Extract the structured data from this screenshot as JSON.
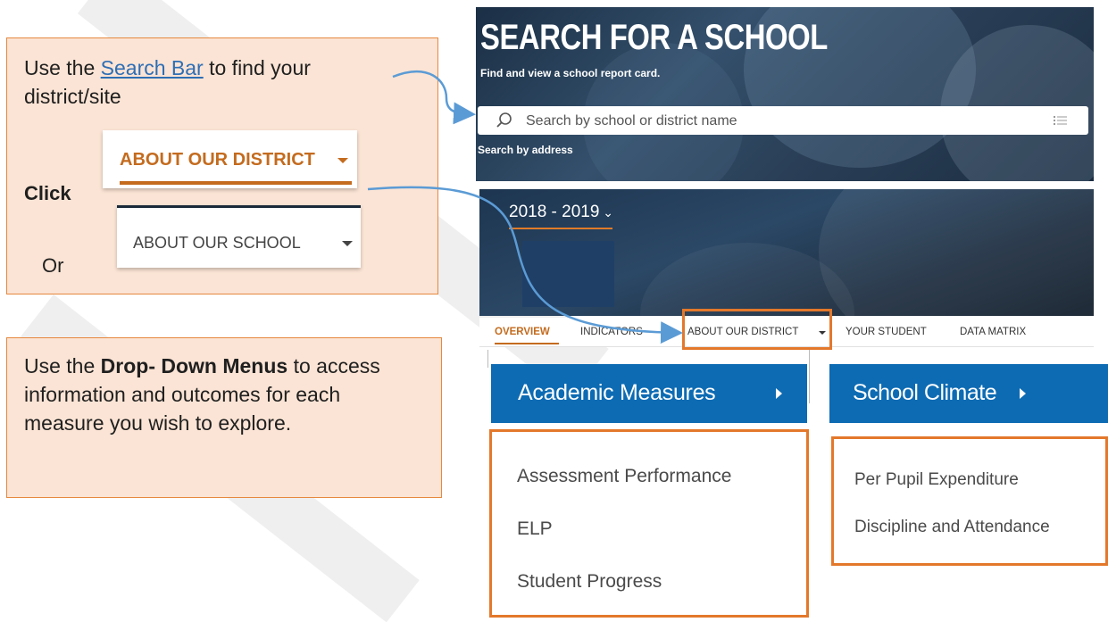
{
  "callout1": {
    "line1_pre": "Use the ",
    "line1_link": "Search Bar",
    "line1_post": " to find your",
    "line2": "district/site",
    "click_label": "Click",
    "or_label": "Or",
    "district_tab": "ABOUT OUR DISTRICT",
    "school_tab": "ABOUT OUR SCHOOL"
  },
  "callout2": {
    "pre": "Use the ",
    "bold": "Drop- Down Menus",
    "post": " to access information and outcomes for each measure you wish to explore."
  },
  "search": {
    "title": "SEARCH FOR A SCHOOL",
    "subtitle": "Find and view a school report card.",
    "placeholder": "Search by school or district name",
    "address_link": "Search by address"
  },
  "year": {
    "label": "2018 - 2019"
  },
  "nav": {
    "items": [
      "OVERVIEW",
      "INDICATORS",
      "ABOUT OUR DISTRICT",
      "YOUR STUDENT",
      "DATA MATRIX"
    ]
  },
  "menus": {
    "academic": {
      "label": "Academic Measures",
      "items": [
        "Assessment Performance",
        "ELP",
        "Student Progress"
      ]
    },
    "climate": {
      "label": "School Climate",
      "items": [
        "Per Pupil Expenditure",
        "Discipline and Attendance"
      ]
    }
  },
  "colors": {
    "accent_orange": "#e3782b",
    "menu_blue": "#0d6bb3",
    "callout_bg": "#fbe4d5",
    "arrow_blue": "#5b9bd5"
  }
}
